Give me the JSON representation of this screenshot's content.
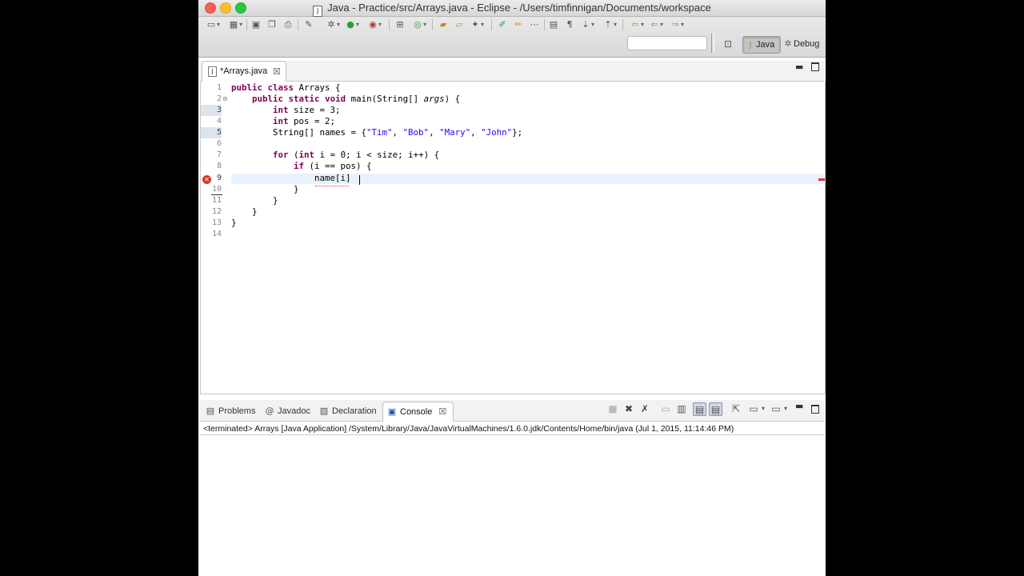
{
  "window": {
    "title": "Java - Practice/src/Arrays.java - Eclipse - /Users/timfinnigan/Documents/workspace"
  },
  "toolbar": {
    "search_value": "",
    "perspectives": [
      "Java",
      "Debug"
    ]
  },
  "editor": {
    "tab_label": "*Arrays.java",
    "line_numbers": [
      "1",
      "2",
      "3",
      "4",
      "5",
      "6",
      "7",
      "8",
      "9",
      "10",
      "11",
      "12",
      "13",
      "14"
    ],
    "code_lines": [
      "public class Arrays {",
      "    public static void main(String[] args) {",
      "        int size = 3;",
      "        int pos = 2;",
      "        String[] names = {\"Tim\", \"Bob\", \"Mary\", \"John\"};",
      "",
      "        for (int i = 0; i < size; i++) {",
      "            if (i == pos) {",
      "                name[i] ",
      "            }",
      "        }",
      "    }",
      "}",
      ""
    ]
  },
  "bottom_panel": {
    "tabs": [
      "Problems",
      "Javadoc",
      "Declaration",
      "Console"
    ],
    "active_tab": "Console",
    "console_header": "<terminated> Arrays [Java Application] /System/Library/Java/JavaVirtualMachines/1.6.0.jdk/Contents/Home/bin/java (Jul 1, 2015, 11:14:46 PM)"
  },
  "colors": {
    "keyword": "#7f0055",
    "string": "#2a00ff",
    "current_line": "#e8f2fe",
    "error": "#d9352a"
  }
}
